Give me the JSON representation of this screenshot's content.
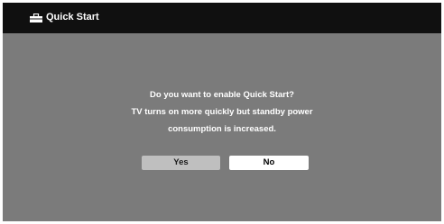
{
  "header": {
    "title": "Quick Start",
    "icon": "toolbox-icon"
  },
  "dialog": {
    "lines": [
      "Do you want to enable Quick Start?",
      "TV turns on more quickly but standby power",
      "consumption is increased."
    ],
    "buttons": {
      "yes_label": "Yes",
      "no_label": "No"
    }
  },
  "colors": {
    "background": "#7b7b7b",
    "title_bar": "#101010",
    "yes_button": "#bfbfbf",
    "no_button": "#ffffff"
  }
}
